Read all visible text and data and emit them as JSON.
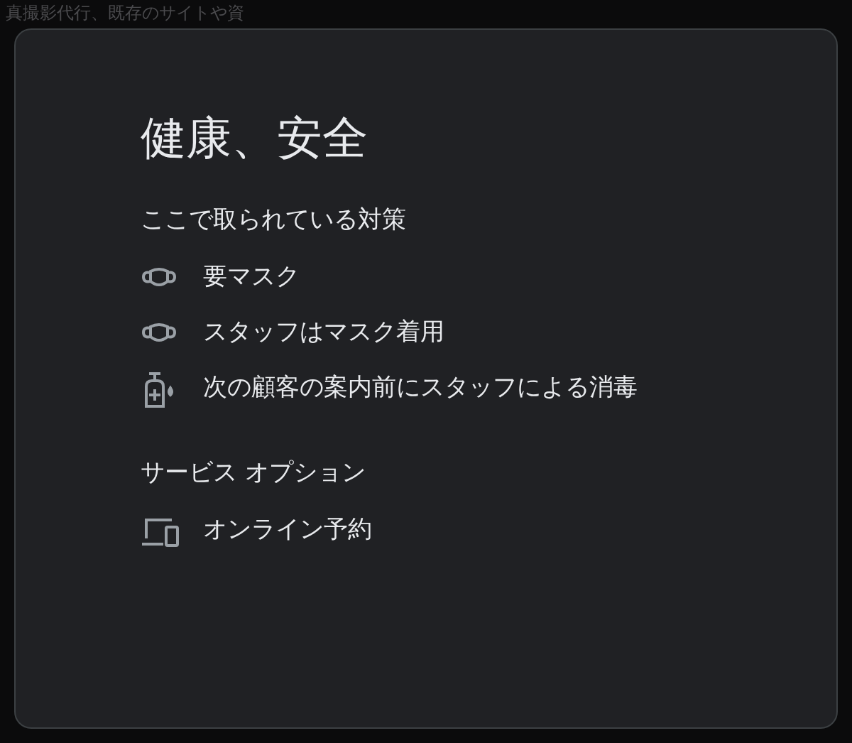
{
  "backdrop": {
    "text": "真撮影代行、既存のサイトや資"
  },
  "dialog": {
    "title": "健康、安全",
    "sections": [
      {
        "heading": "ここで取られている対策",
        "items": [
          {
            "kind": "mask",
            "label": "要マスク"
          },
          {
            "kind": "mask",
            "label": "スタッフはマスク着用"
          },
          {
            "kind": "sanitizer",
            "label": "次の顧客の案内前にスタッフによる消毒"
          }
        ]
      },
      {
        "heading": "サービス オプション",
        "items": [
          {
            "kind": "devices",
            "label": "オンライン予約"
          }
        ]
      }
    ]
  }
}
